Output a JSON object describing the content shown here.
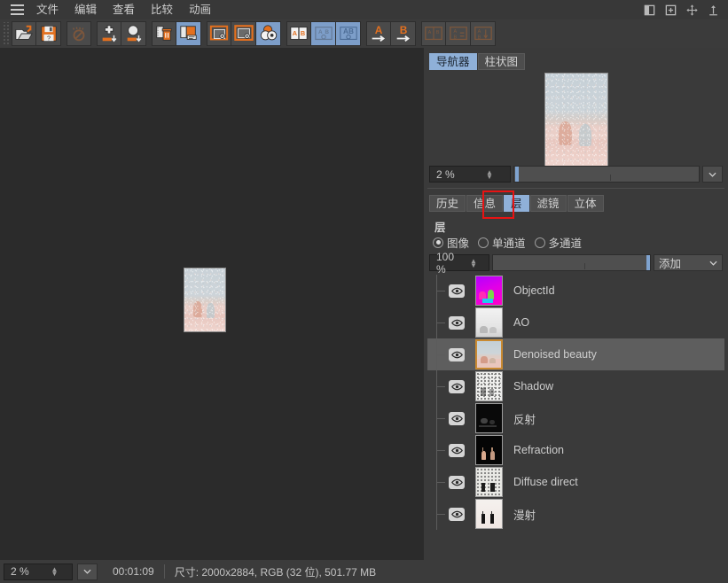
{
  "app": {
    "menu": {
      "hamburger_icon": "hamburger-menu-icon",
      "items": [
        {
          "label": "文件"
        },
        {
          "label": "编辑"
        },
        {
          "label": "查看"
        },
        {
          "label": "比较"
        },
        {
          "label": "动画"
        }
      ],
      "right_icons": [
        {
          "name": "split-panel-icon"
        },
        {
          "name": "add-panel-icon"
        },
        {
          "name": "move-pan-icon"
        },
        {
          "name": "anchor-up-icon"
        }
      ]
    },
    "toolbar": {
      "groups": [
        {
          "buttons": [
            {
              "name": "open-file-button",
              "icon": "folder-open-icon",
              "state": "normal"
            },
            {
              "name": "save-file-button",
              "icon": "floppy-save-icon",
              "state": "normal"
            }
          ]
        },
        {
          "buttons": [
            {
              "name": "no-render-button",
              "icon": "no-entry-icon",
              "state": "disabled"
            }
          ]
        },
        {
          "buttons": [
            {
              "name": "move-down-button",
              "icon": "move-arrows-down-icon",
              "state": "normal"
            },
            {
              "name": "circle-down-button",
              "icon": "circle-down-icon",
              "state": "normal"
            }
          ]
        },
        {
          "buttons": [
            {
              "name": "delete-layer-button",
              "icon": "trash-icon",
              "state": "normal"
            },
            {
              "name": "copy-layer-button",
              "icon": "copy-pages-icon",
              "state": "active"
            }
          ]
        },
        {
          "buttons": [
            {
              "name": "view-single-button",
              "icon": "frame-view-icon",
              "state": "normal"
            },
            {
              "name": "view-fit-button",
              "icon": "frame-fit-icon",
              "state": "normal"
            },
            {
              "name": "view-compare-button",
              "icon": "overlap-compare-icon",
              "state": "active"
            }
          ]
        },
        {
          "buttons": [
            {
              "name": "ab-split-button",
              "icon": "ab-split-icon",
              "state": "normal"
            },
            {
              "name": "ab-view-a-button",
              "icon": "ab-view-a-icon",
              "state": "active-dim"
            },
            {
              "name": "ab-view-b-button",
              "icon": "ab-view-b-icon",
              "state": "active"
            }
          ]
        },
        {
          "buttons": [
            {
              "name": "set-a-button",
              "icon": "letter-a-arrow-icon",
              "state": "normal"
            },
            {
              "name": "set-b-button",
              "icon": "letter-b-arrow-icon",
              "state": "normal"
            }
          ]
        },
        {
          "buttons": [
            {
              "name": "layout-side-by-side-button",
              "icon": "layout-ab-side-icon",
              "state": "disabled"
            },
            {
              "name": "layout-difference-button",
              "icon": "layout-ab-diff-icon",
              "state": "disabled"
            },
            {
              "name": "layout-stack-button",
              "icon": "layout-ab-stack-icon",
              "state": "disabled"
            }
          ]
        }
      ]
    },
    "canvas": {
      "name": "image-canvas",
      "image_alt": "noisy-render-preview"
    },
    "navigator_panel": {
      "tabs": [
        {
          "label": "导航器",
          "active": true
        },
        {
          "label": "柱状图",
          "active": false
        }
      ],
      "preview_alt": "navigator-thumbnail",
      "zoom": {
        "value": "2 %",
        "slider_percent": 3,
        "dropdown_icon": "chevron-down-icon"
      }
    },
    "layers_panel": {
      "tabs": [
        {
          "label": "历史",
          "active": false
        },
        {
          "label": "信息",
          "active": false
        },
        {
          "label": "层",
          "active": true
        },
        {
          "label": "滤镜",
          "active": false
        },
        {
          "label": "立体",
          "active": false
        }
      ],
      "annotation": {
        "name": "red-highlight-box",
        "color": "#e81313",
        "around_tab": "层"
      },
      "title": "层",
      "channel_modes": [
        {
          "label": "图像",
          "selected": true
        },
        {
          "label": "单通道",
          "selected": false
        },
        {
          "label": "多通道",
          "selected": false
        }
      ],
      "opacity": {
        "value": "100 %",
        "slider_percent": 100
      },
      "blend_mode": {
        "value": "添加",
        "dropdown_icon": "chevron-down-icon"
      },
      "layers": [
        {
          "name": "ObjectId",
          "visible": true,
          "selected": false,
          "thumb": "objectid"
        },
        {
          "name": "AO",
          "visible": true,
          "selected": false,
          "thumb": "ao"
        },
        {
          "name": "Denoised beauty",
          "visible": true,
          "selected": true,
          "thumb": "beauty"
        },
        {
          "name": "Shadow",
          "visible": true,
          "selected": false,
          "thumb": "shadow"
        },
        {
          "name": "反射",
          "visible": true,
          "selected": false,
          "thumb": "reflect"
        },
        {
          "name": "Refraction",
          "visible": true,
          "selected": false,
          "thumb": "refract"
        },
        {
          "name": "Diffuse direct",
          "visible": true,
          "selected": false,
          "thumb": "diffusedirect"
        },
        {
          "name": "漫射",
          "visible": true,
          "selected": false,
          "thumb": "diffuse"
        }
      ]
    },
    "statusbar": {
      "zoom_value": "2 %",
      "dropdown_icon": "chevron-down-icon",
      "time": "00:01:09",
      "info": "尺寸: 2000x2884, RGB (32 位), 501.77 MB"
    },
    "colors": {
      "accent_blue": "#8fb0d8",
      "accent_orange": "#e3701f",
      "annotation_red": "#e81313",
      "panel_bg": "#3a3a3a",
      "canvas_bg": "#2b2b2b",
      "selection_row": "#5e5e5e"
    }
  }
}
